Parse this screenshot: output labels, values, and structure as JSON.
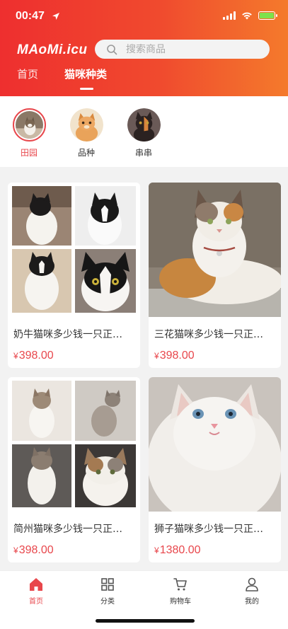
{
  "status_bar": {
    "time": "00:47",
    "icons": [
      "location-arrow-icon",
      "signal-icon",
      "wifi-icon",
      "battery-charging-icon"
    ]
  },
  "header": {
    "logo": "MAoMi.icu",
    "search": {
      "placeholder": "搜索商品",
      "icon": "search-icon"
    },
    "tabs": [
      {
        "label": "首页",
        "active": false
      },
      {
        "label": "猫咪种类",
        "active": true
      }
    ]
  },
  "categories": [
    {
      "label": "田园",
      "active": true
    },
    {
      "label": "品种",
      "active": false
    },
    {
      "label": "串串",
      "active": false
    }
  ],
  "products": [
    {
      "title": "奶牛猫咪多少钱一只正…",
      "currency": "¥",
      "price": "398.00"
    },
    {
      "title": "三花猫咪多少钱一只正…",
      "currency": "¥",
      "price": "398.00"
    },
    {
      "title": "简州猫咪多少钱一只正…",
      "currency": "¥",
      "price": "398.00"
    },
    {
      "title": "狮子猫咪多少钱一只正…",
      "currency": "¥",
      "price": "1380.00"
    }
  ],
  "bottom_nav": [
    {
      "label": "首页",
      "icon": "home-icon",
      "active": true
    },
    {
      "label": "分类",
      "icon": "grid-icon",
      "active": false
    },
    {
      "label": "购物车",
      "icon": "cart-icon",
      "active": false
    },
    {
      "label": "我的",
      "icon": "user-icon",
      "active": false
    }
  ],
  "colors": {
    "accent": "#e8474c",
    "header_start": "#ee2f2f",
    "header_end": "#f47a2c"
  }
}
